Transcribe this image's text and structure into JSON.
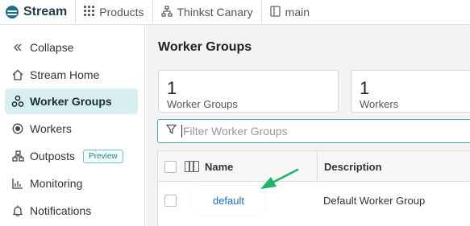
{
  "topbar": {
    "brand": "Stream",
    "nav": [
      {
        "label": "Products",
        "icon": "grid-icon"
      },
      {
        "label": "Thinkst Canary",
        "icon": "hierarchy-icon"
      },
      {
        "label": "main",
        "icon": "book-icon"
      }
    ]
  },
  "sidebar": {
    "items": [
      {
        "label": "Collapse",
        "icon": "double-chevron-left-icon"
      },
      {
        "label": "Stream Home",
        "icon": "home-icon"
      },
      {
        "label": "Worker Groups",
        "icon": "worker-groups-icon",
        "active": true
      },
      {
        "label": "Workers",
        "icon": "worker-icon"
      },
      {
        "label": "Outposts",
        "icon": "outposts-icon",
        "badge": "Preview"
      },
      {
        "label": "Monitoring",
        "icon": "chart-icon"
      },
      {
        "label": "Notifications",
        "icon": "bell-icon"
      }
    ]
  },
  "main": {
    "title": "Worker Groups",
    "stats": [
      {
        "value": "1",
        "label": "Worker Groups"
      },
      {
        "value": "1",
        "label": "Workers"
      }
    ],
    "filter": {
      "placeholder": "Filter Worker Groups",
      "value": ""
    },
    "table": {
      "headers": [
        "Name",
        "Description"
      ],
      "rows": [
        {
          "name": "default",
          "description": "Default Worker Group"
        }
      ]
    }
  },
  "colors": {
    "accent": "#1e6f8a",
    "active_bg": "#d8eef0",
    "link": "#1b6fb3",
    "arrow": "#21b26b",
    "badge": "#1d7f86"
  }
}
